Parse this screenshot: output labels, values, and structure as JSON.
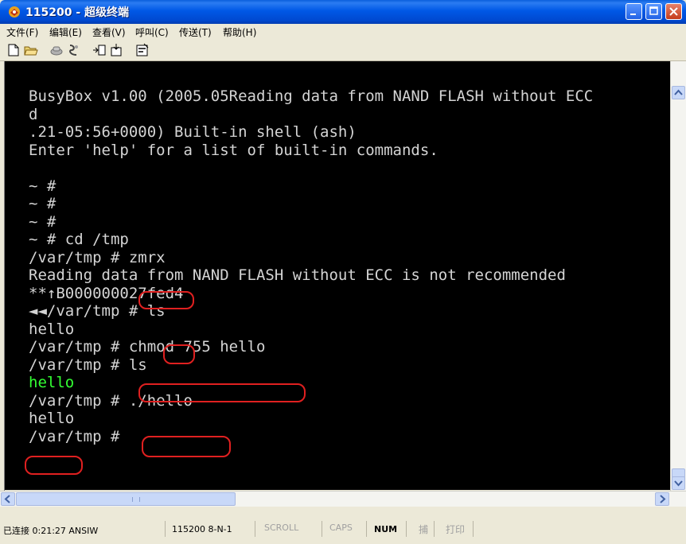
{
  "window": {
    "title": "115200 - 超级终端"
  },
  "menu": [
    {
      "label": "文件(F)"
    },
    {
      "label": "编辑(E)"
    },
    {
      "label": "查看(V)"
    },
    {
      "label": "呼叫(C)"
    },
    {
      "label": "传送(T)"
    },
    {
      "label": "帮助(H)"
    }
  ],
  "toolbar": [
    {
      "icon": "new-document-icon"
    },
    {
      "icon": "open-folder-icon"
    },
    {
      "icon": "call-icon"
    },
    {
      "icon": "disconnect-icon"
    },
    {
      "icon": "send-icon"
    },
    {
      "icon": "receive-icon"
    },
    {
      "icon": "properties-icon"
    }
  ],
  "terminal": {
    "lines": [
      {
        "text": "BusyBox v1.00 (2005.05Reading data from NAND FLASH without ECC",
        "color": "#d4d4d4"
      },
      {
        "text": "d",
        "color": "#d4d4d4"
      },
      {
        "text": ".21-05:56+0000) Built-in shell (ash)",
        "color": "#d4d4d4"
      },
      {
        "text": "Enter 'help' for a list of built-in commands.",
        "color": "#d4d4d4"
      },
      {
        "text": "",
        "color": "#d4d4d4"
      },
      {
        "text": "~ #",
        "color": "#d4d4d4"
      },
      {
        "text": "~ #",
        "color": "#d4d4d4"
      },
      {
        "text": "~ #",
        "color": "#d4d4d4"
      },
      {
        "text": "~ # cd /tmp",
        "color": "#d4d4d4"
      },
      {
        "text": "/var/tmp # zmrx",
        "color": "#d4d4d4"
      },
      {
        "text": "Reading data from NAND FLASH without ECC is not recommended",
        "color": "#d4d4d4"
      },
      {
        "text": "**↑B000000027fed4",
        "color": "#d4d4d4"
      },
      {
        "text": "◄◄/var/tmp # ls",
        "color": "#d4d4d4"
      },
      {
        "text": "hello",
        "color": "#d4d4d4"
      },
      {
        "text": "/var/tmp # chmod 755 hello",
        "color": "#d4d4d4"
      },
      {
        "text": "/var/tmp # ls",
        "color": "#d4d4d4"
      },
      {
        "text": "hello",
        "color": "#33ff33"
      },
      {
        "text": "/var/tmp # ./hello",
        "color": "#d4d4d4"
      },
      {
        "text": "hello",
        "color": "#d4d4d4"
      },
      {
        "text": "/var/tmp #",
        "color": "#d4d4d4"
      }
    ]
  },
  "status": {
    "connection": "已连接 0:21:27 ANSIW",
    "port": "115200 8-N-1",
    "scroll": "SCROLL",
    "caps": "CAPS",
    "num": "NUM",
    "capture": "捕",
    "print": "打印"
  },
  "colors": {
    "titlebar": "#0058e6",
    "terminal_bg": "#000000",
    "highlight": "#e02020",
    "green_text": "#33ff33"
  }
}
